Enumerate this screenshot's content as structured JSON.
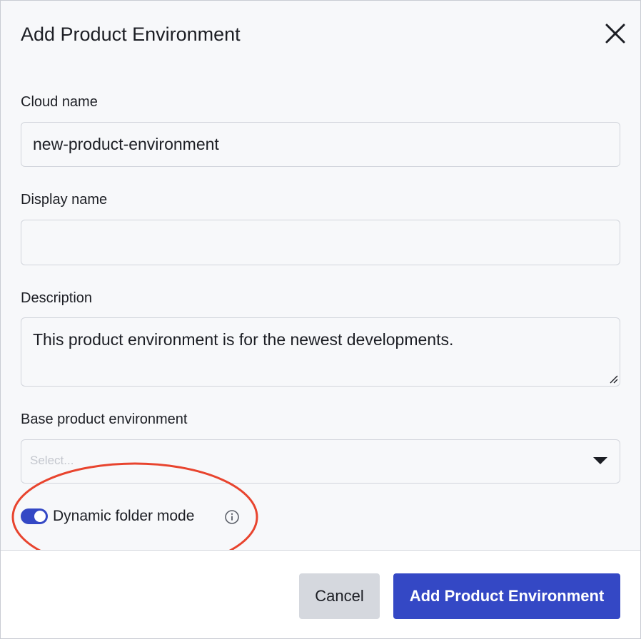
{
  "dialog": {
    "title": "Add Product Environment",
    "close_icon": "close-icon"
  },
  "form": {
    "cloud_name": {
      "label": "Cloud name",
      "value": "new-product-environment"
    },
    "display_name": {
      "label": "Display name",
      "value": ""
    },
    "description": {
      "label": "Description",
      "value": "This product environment is for the newest developments."
    },
    "base_env": {
      "label": "Base product environment",
      "placeholder": "Select...",
      "icon": "chevron-down-icon"
    },
    "dynamic_folder": {
      "label": "Dynamic folder mode",
      "enabled": true,
      "info_icon": "info-icon"
    }
  },
  "footer": {
    "cancel_label": "Cancel",
    "submit_label": "Add Product Environment"
  },
  "colors": {
    "primary": "#3448c5",
    "annotation": "#e8442e",
    "background": "#f7f8fa"
  }
}
